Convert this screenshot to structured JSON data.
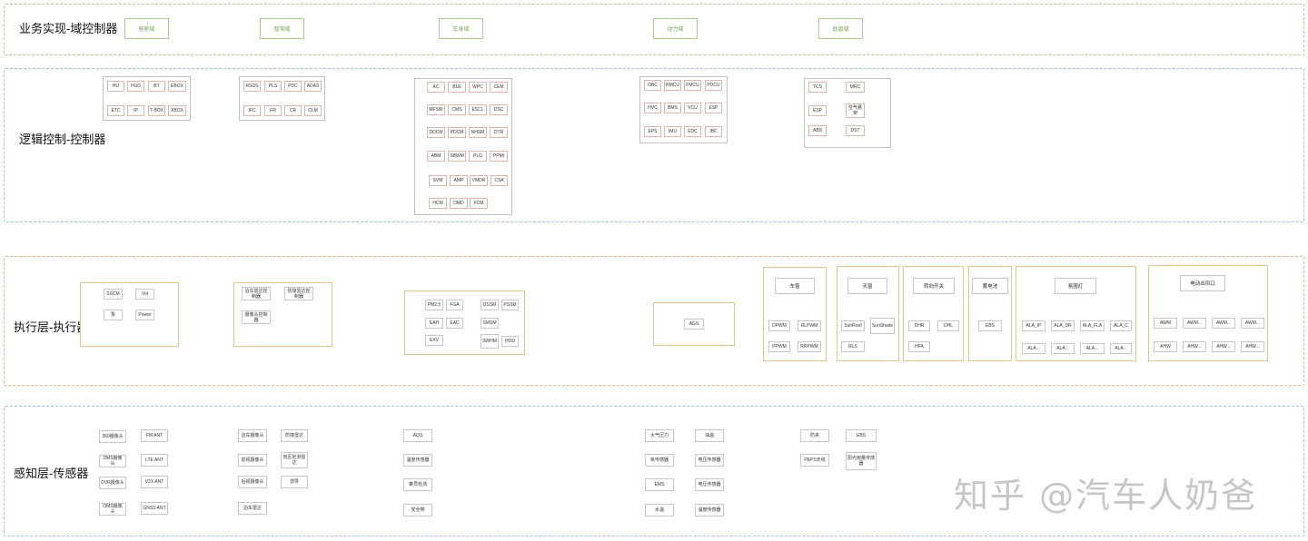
{
  "layers": {
    "business": {
      "label": "业务实现-域控制器",
      "domains": [
        "座舱域",
        "智驾域",
        "车身域",
        "动力域",
        "底盘域"
      ]
    },
    "logic": {
      "label": "逻辑控制-控制器",
      "groups": [
        [
          "HU",
          "HUD",
          "BT",
          "EBOX",
          "ETC",
          "IP",
          "T-BOX",
          "XBOX"
        ],
        [
          "RSDS",
          "PLS",
          "PDC",
          "ADAS",
          "IFC",
          "FR",
          "CR",
          "CLM"
        ],
        [
          "AC",
          "BLE",
          "WPC",
          "CEM",
          "MFSW",
          "CMS",
          "ESCL",
          "DSC",
          "DDCM",
          "PDCM",
          "NHSM",
          "DTR",
          "ABM",
          "SBWM",
          "PLG",
          "PPMI",
          "SVM",
          "AMP",
          "VMDR",
          "CSA",
          "HCM",
          "DMD",
          "FCM"
        ],
        [
          "OBC",
          "RMCU",
          "FMCU",
          "PDCU",
          "HVC",
          "BMS",
          "VCU",
          "ESP",
          "EPS",
          "IMU",
          "EDC",
          "IBC"
        ],
        [
          "TCS",
          "MRC",
          "ESP",
          "空气悬架",
          "ABS",
          "DST"
        ]
      ]
    },
    "actuator": {
      "label": "执行层-执行器",
      "groupA": [
        "SSCM",
        "Vol",
        "泵",
        "Power"
      ],
      "groupB": [
        "泊车雷达控制器",
        "防撞雷达控制器",
        "摄像头控制器"
      ],
      "groupC": [
        "PM2.5",
        "FGA",
        "DSSM",
        "PSSM",
        "EAH",
        "EAC",
        "SMSM",
        "EXV",
        "SWHM",
        "HOD"
      ],
      "single": "AGS",
      "window": {
        "title": "车窗",
        "items": [
          "DPWM",
          "RLPWM",
          "PPWM",
          "RRPWM"
        ]
      },
      "sunroof": {
        "title": "天窗",
        "items": [
          "SunRoof",
          "SunShade",
          "RLS"
        ]
      },
      "steering_switch": {
        "title": "转向开关",
        "items": [
          "DHR",
          "DHL",
          "HFA"
        ]
      },
      "battery": {
        "title": "蓄电池",
        "items": [
          "EBS"
        ]
      },
      "ambient": {
        "title": "氛围灯",
        "items": [
          "ALA_IP",
          "ALA_DR",
          "ALA_FLA",
          "ALA_C",
          "ALA...",
          "ALA...",
          "ALA...",
          "ALA..."
        ]
      },
      "vent": {
        "title": "电动出风口",
        "items": [
          "AWM",
          "AWM...",
          "AWM...",
          "AWM...",
          "AHW",
          "AHW...",
          "AHW...",
          "AHW..."
        ]
      }
    },
    "sensor": {
      "label": "感知层-传感器",
      "col1": [
        "360摄像头",
        "DMS摄像头",
        "DVR摄像头",
        "OMS摄像头"
      ],
      "col2": [
        "FM ANT",
        "LTE ANT",
        "V2X ANT",
        "GNSS ANT"
      ],
      "col3": [
        "泊车摄像头",
        "前视摄像头",
        "后视摄像头",
        "泊车雷达"
      ],
      "col4": [
        "防撞雷达",
        "盲区检测雷达",
        "惯导"
      ],
      "col5": [
        "AQS",
        "温度传感器",
        "乘员检测",
        "安全带"
      ],
      "col6": [
        "大气压力",
        "氧传感器",
        "EMS",
        "水温"
      ],
      "col7": [
        "油温",
        "电压传感器",
        "电压传感器",
        "温度传感器"
      ],
      "col8": [
        "防夹",
        "PEPS天线"
      ],
      "col9": [
        "EBS",
        "阳光雨量传感器"
      ]
    }
  },
  "watermark": "知乎 @汽车人奶爸",
  "colors": {
    "business_border": "#a9d08e",
    "logic_border": "#9dc3e6",
    "actuator_border": "#f4b183",
    "sensor_border": "#9dc3e6",
    "box_border": "#e0b6a8",
    "group_border_gold": "#e0c98a"
  }
}
